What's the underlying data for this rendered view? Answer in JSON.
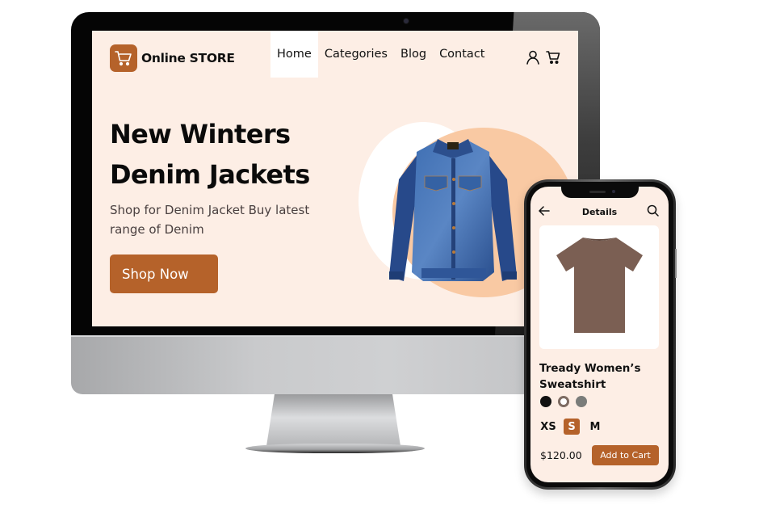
{
  "desktop": {
    "logo": {
      "text": "Online STORE",
      "icon": "cart-icon"
    },
    "nav": {
      "items": [
        {
          "label": "Home",
          "active": true
        },
        {
          "label": "Categories",
          "active": false
        },
        {
          "label": "Blog",
          "active": false
        },
        {
          "label": "Contact",
          "active": false
        }
      ],
      "icons": [
        "user-icon",
        "cart-icon"
      ]
    },
    "hero": {
      "title_line1": "New Winters",
      "title_line2": "Denim Jackets",
      "subtitle": "Shop for Denim Jacket  Buy latest range of Denim",
      "cta_label": "Shop Now",
      "product_image": "denim-jacket"
    }
  },
  "mobile": {
    "header": {
      "title": "Details",
      "back_icon": "arrow-left-icon",
      "search_icon": "search-icon"
    },
    "product": {
      "image": "brown-tshirt",
      "name": "Tready Women’s Sweatshirt",
      "colors": [
        {
          "name": "black",
          "hex": "#111111",
          "selected": false
        },
        {
          "name": "brown-outline",
          "hex": "#7d6b62",
          "selected": true
        },
        {
          "name": "grey",
          "hex": "#7a7c7a",
          "selected": false
        }
      ],
      "sizes": [
        {
          "label": "XS",
          "active": false
        },
        {
          "label": "S",
          "active": true
        },
        {
          "label": "M",
          "active": false
        }
      ],
      "price": "$120.00",
      "add_to_cart_label": "Add to Cart"
    }
  },
  "theme": {
    "accent": "#b5622a",
    "screen_bg": "#fdeee5",
    "peach_circle": "#f9c9a3"
  }
}
